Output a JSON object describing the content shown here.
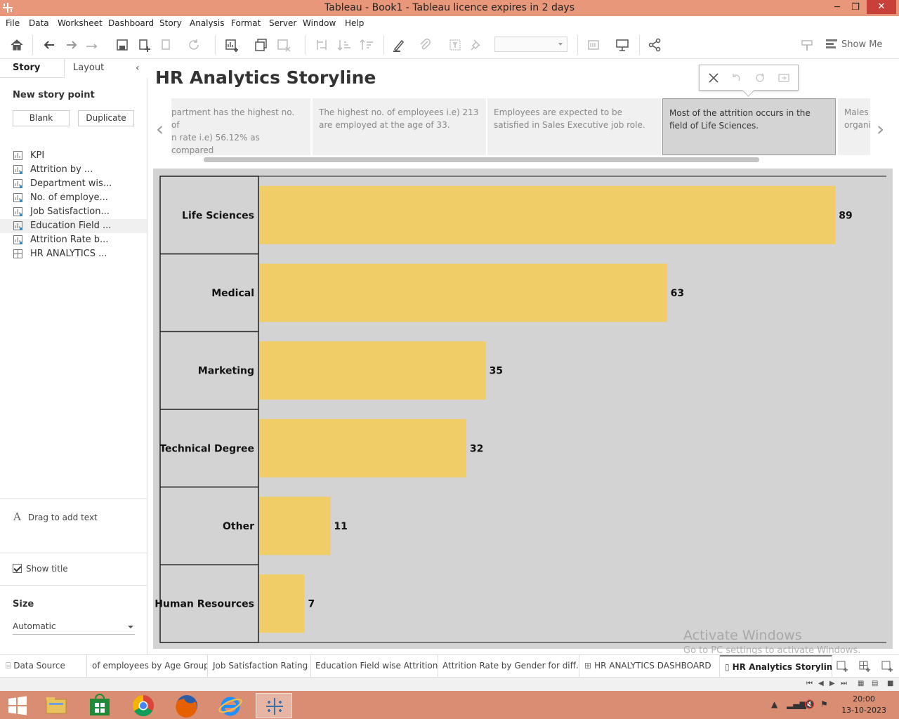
{
  "window": {
    "title": "Tableau - Book1 - Tableau licence expires in 2 days",
    "minimize_label": "─",
    "restore_label": "❐",
    "close_label": "✕"
  },
  "menu": [
    "File",
    "Data",
    "Worksheet",
    "Dashboard",
    "Story",
    "Analysis",
    "Format",
    "Server",
    "Window",
    "Help"
  ],
  "toolbar": {
    "show_me": "Show Me"
  },
  "sidebar": {
    "tab_story": "Story",
    "tab_layout": "Layout",
    "new_story_point": "New story point",
    "blank_button": "Blank",
    "duplicate_button": "Duplicate",
    "sheets": [
      {
        "label": "KPI",
        "icon": "worksheet-icon"
      },
      {
        "label": "Attrition by ...",
        "icon": "worksheet-icon"
      },
      {
        "label": "Department wis...",
        "icon": "worksheet-icon"
      },
      {
        "label": "No. of employe...",
        "icon": "worksheet-icon"
      },
      {
        "label": "Job Satisfaction...",
        "icon": "worksheet-icon"
      },
      {
        "label": "Education Field ...",
        "icon": "worksheet-icon"
      },
      {
        "label": "Attrition Rate b...",
        "icon": "worksheet-icon"
      },
      {
        "label": "HR ANALYTICS ...",
        "icon": "dashboard-icon"
      }
    ],
    "drag_text_icon": "A",
    "drag_text": "Drag to add text",
    "show_title": "Show title",
    "size_label": "Size",
    "size_value": "Automatic"
  },
  "story": {
    "title": "HR Analytics Storyline",
    "points": [
      {
        "text": "partment has the highest no. of\nn rate i.e) 56.12% as compared\nr departments.",
        "active": false
      },
      {
        "text": "The highest no. of employees i.e) 213 are employed at the age of 33.",
        "active": false
      },
      {
        "text": "Employees are expected to be satisfied in Sales Executive job role.",
        "active": false
      },
      {
        "text": "Most of the attrition occurs in the field of Life Sciences.",
        "active": true
      },
      {
        "text": "Males\norgani",
        "active": false
      }
    ]
  },
  "chart_data": {
    "type": "bar",
    "orientation": "horizontal",
    "categories": [
      "Life Sciences",
      "Medical",
      "Marketing",
      "Technical Degree",
      "Other",
      "Human Resources"
    ],
    "values": [
      89,
      63,
      35,
      32,
      11,
      7
    ],
    "title": "",
    "xlabel": "",
    "ylabel": "",
    "xlim": [
      0,
      97
    ],
    "bar_color": "#F0CD66",
    "background": "#D3D3D3",
    "grid": false
  },
  "watermark": {
    "line1": "Activate Windows",
    "line2": "Go to PC settings to activate Windows."
  },
  "sheet_tabs": [
    {
      "label": "Data Source",
      "icon": "database-icon"
    },
    {
      "label": "of employees by Age Group"
    },
    {
      "label": "Job Satisfaction Rating"
    },
    {
      "label": "Education Field wise Attrition"
    },
    {
      "label": "Attrition Rate by Gender for diff..."
    },
    {
      "label": "HR ANALYTICS DASHBOARD",
      "icon": "dashboard-icon"
    },
    {
      "label": "HR Analytics Storyline",
      "icon": "story-icon",
      "active": true
    }
  ],
  "taskbar": {
    "time": "20:00",
    "date": "13-10-2023"
  }
}
